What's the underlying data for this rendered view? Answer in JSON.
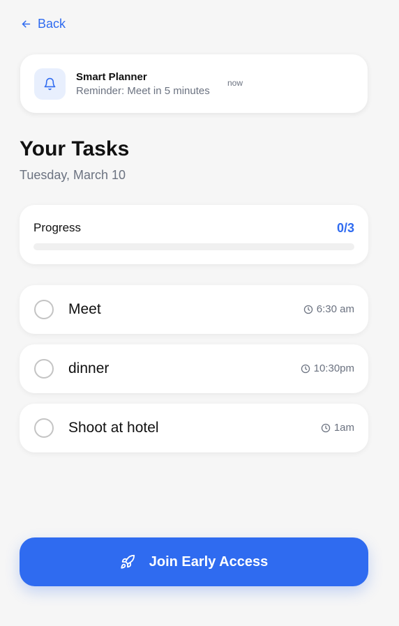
{
  "nav": {
    "back_label": "Back",
    "back_icon": "arrow-left-icon"
  },
  "notification": {
    "icon": "bell-icon",
    "app_name": "Smart Planner",
    "message": "Reminder: Meet in 5 minutes",
    "time": "now"
  },
  "header": {
    "title": "Your Tasks",
    "date": "Tuesday, March 10"
  },
  "progress": {
    "label": "Progress",
    "count": "0/3",
    "fraction": 0
  },
  "tasks": [
    {
      "title": "Meet",
      "time": "6:30 am",
      "done": false
    },
    {
      "title": "dinner",
      "time": "10:30pm",
      "done": false
    },
    {
      "title": "Shoot at hotel",
      "time": "1am",
      "done": false
    }
  ],
  "cta": {
    "label": "Join Early Access",
    "icon": "rocket-icon"
  },
  "colors": {
    "accent": "#2f6bf0",
    "background": "#f6f6f6",
    "card": "#ffffff",
    "muted_text": "#6b7280",
    "icon_tile": "#e8effd"
  }
}
